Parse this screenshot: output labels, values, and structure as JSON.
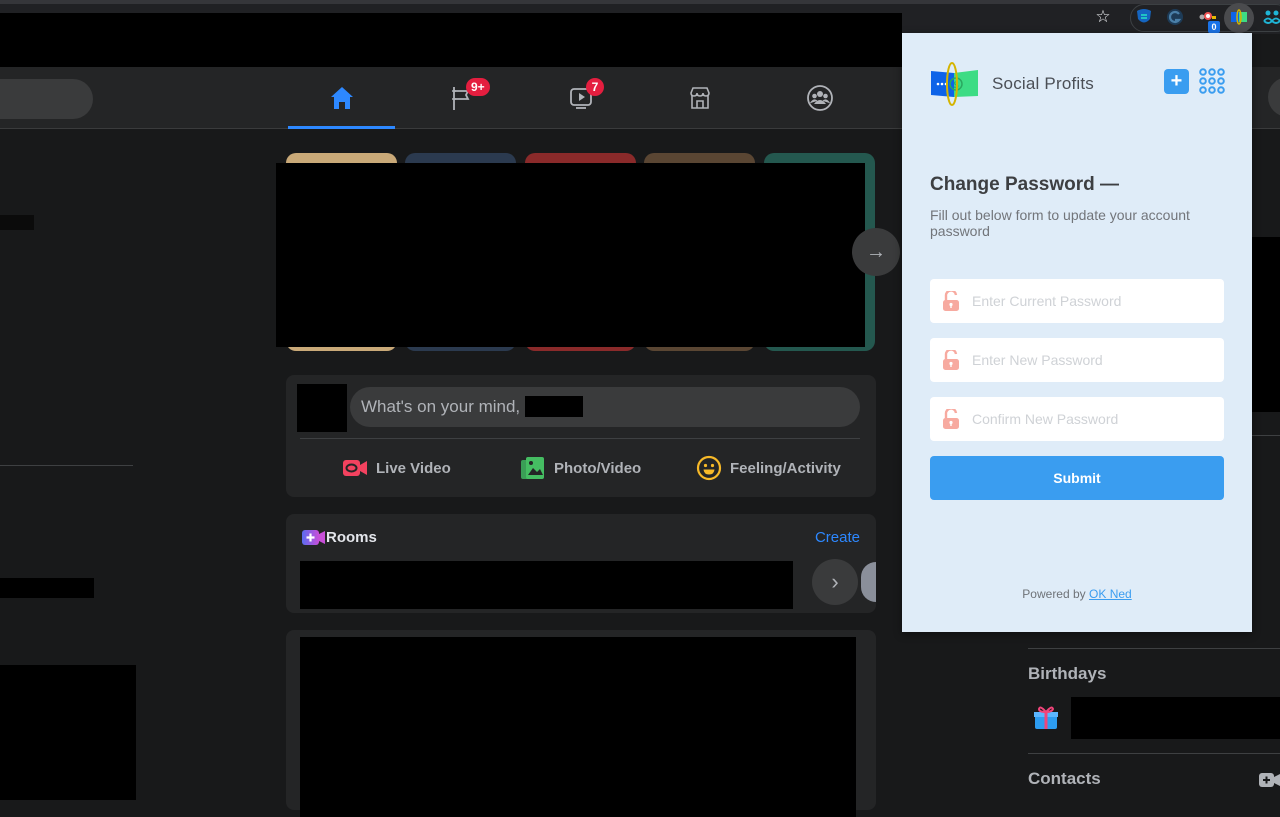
{
  "browser": {
    "bookmark_icon": "star-icon",
    "extensions": [
      {
        "name": "shield-s-extension-icon"
      },
      {
        "name": "g-chat-extension-icon"
      },
      {
        "name": "tracker-extension-icon",
        "badge": "0"
      },
      {
        "name": "social-profits-extension-icon",
        "active": true
      },
      {
        "name": "people-extension-icon"
      }
    ]
  },
  "fb_header": {
    "nav": [
      {
        "name": "home",
        "icon": "home-icon",
        "active": true
      },
      {
        "name": "pages",
        "icon": "flag-icon",
        "badge": "9+"
      },
      {
        "name": "watch",
        "icon": "video-icon",
        "badge": "7"
      },
      {
        "name": "marketplace",
        "icon": "store-icon"
      },
      {
        "name": "groups",
        "icon": "groups-icon"
      }
    ],
    "colors": {
      "accent": "#2d88ff",
      "badge": "#e41e3f"
    }
  },
  "composer": {
    "prompt": "What's on your mind,",
    "actions": [
      {
        "label": "Live Video",
        "icon": "live-video-icon",
        "color": "#f3425f"
      },
      {
        "label": "Photo/Video",
        "icon": "photo-icon",
        "color": "#45bd62"
      },
      {
        "label": "Feeling/Activity",
        "icon": "smiley-icon",
        "color": "#f7b928"
      }
    ]
  },
  "rooms": {
    "title": "Rooms",
    "create_label": "Create",
    "next_icon": "chevron-right-icon"
  },
  "right_sidebar": {
    "birthdays_title": "Birthdays",
    "contacts_title": "Contacts"
  },
  "popup": {
    "app_name": "Social Profits",
    "title": "Change Password",
    "title_suffix": "—",
    "description": "Fill out below form to update your account password",
    "fields": [
      {
        "placeholder": "Enter Current Password",
        "value": ""
      },
      {
        "placeholder": "Enter New Password",
        "value": ""
      },
      {
        "placeholder": "Confirm New Password",
        "value": ""
      }
    ],
    "submit_label": "Submit",
    "powered_by": "Powered by",
    "powered_link": "OK Ned",
    "colors": {
      "primary": "#3a9df0",
      "background": "#dfecf8",
      "lock": "#f7aaa0"
    }
  }
}
